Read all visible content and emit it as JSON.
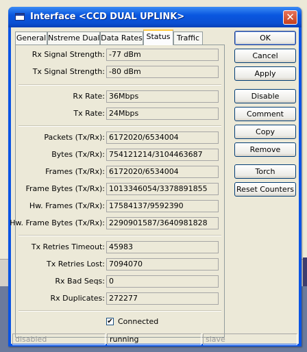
{
  "window": {
    "title": "Interface <CCD DUAL UPLINK>",
    "close_symbol": "✕"
  },
  "tabs": [
    {
      "label": "General",
      "active": false
    },
    {
      "label": "Nstreme Dual",
      "active": false
    },
    {
      "label": "Data Rates",
      "active": false
    },
    {
      "label": "Status",
      "active": true
    },
    {
      "label": "Traffic",
      "active": false
    }
  ],
  "status": {
    "rx_signal_strength": {
      "label": "Rx Signal Strength:",
      "value": "-77 dBm"
    },
    "tx_signal_strength": {
      "label": "Tx Signal Strength:",
      "value": "-80 dBm"
    },
    "rx_rate": {
      "label": "Rx Rate:",
      "value": "36Mbps"
    },
    "tx_rate": {
      "label": "Tx Rate:",
      "value": "24Mbps"
    },
    "packets": {
      "label": "Packets (Tx/Rx):",
      "value": "6172020/6534004"
    },
    "bytes": {
      "label": "Bytes (Tx/Rx):",
      "value": "754121214/3104463687"
    },
    "frames": {
      "label": "Frames (Tx/Rx):",
      "value": "6172020/6534004"
    },
    "frame_bytes": {
      "label": "Frame Bytes (Tx/Rx):",
      "value": "1013346054/3378891855"
    },
    "hw_frames": {
      "label": "Hw. Frames (Tx/Rx):",
      "value": "17584137/9592390"
    },
    "hw_frame_bytes": {
      "label": "Hw. Frame Bytes (Tx/Rx):",
      "value": "2290901587/3640981828"
    },
    "tx_retries_timeout": {
      "label": "Tx Retries Timeout:",
      "value": "45983"
    },
    "tx_retries_lost": {
      "label": "Tx Retries Lost:",
      "value": "7094070"
    },
    "rx_bad_seqs": {
      "label": "Rx Bad Seqs:",
      "value": "0"
    },
    "rx_duplicates": {
      "label": "Rx Duplicates:",
      "value": "272277"
    },
    "connected": {
      "label": "Connected",
      "checked": true,
      "check_symbol": "✔"
    }
  },
  "buttons": {
    "ok": "OK",
    "cancel": "Cancel",
    "apply": "Apply",
    "disable": "Disable",
    "comment": "Comment",
    "copy": "Copy",
    "remove": "Remove",
    "torch": "Torch",
    "reset_counters": "Reset Counters"
  },
  "statusbar": {
    "state": "disabled",
    "running": "running",
    "slave": "slave"
  },
  "colors": {
    "titlebar": "#0a54e4",
    "dialog_bg": "#ece9d8",
    "tab_highlight": "#ffc83c",
    "close_button": "#c4401e"
  }
}
